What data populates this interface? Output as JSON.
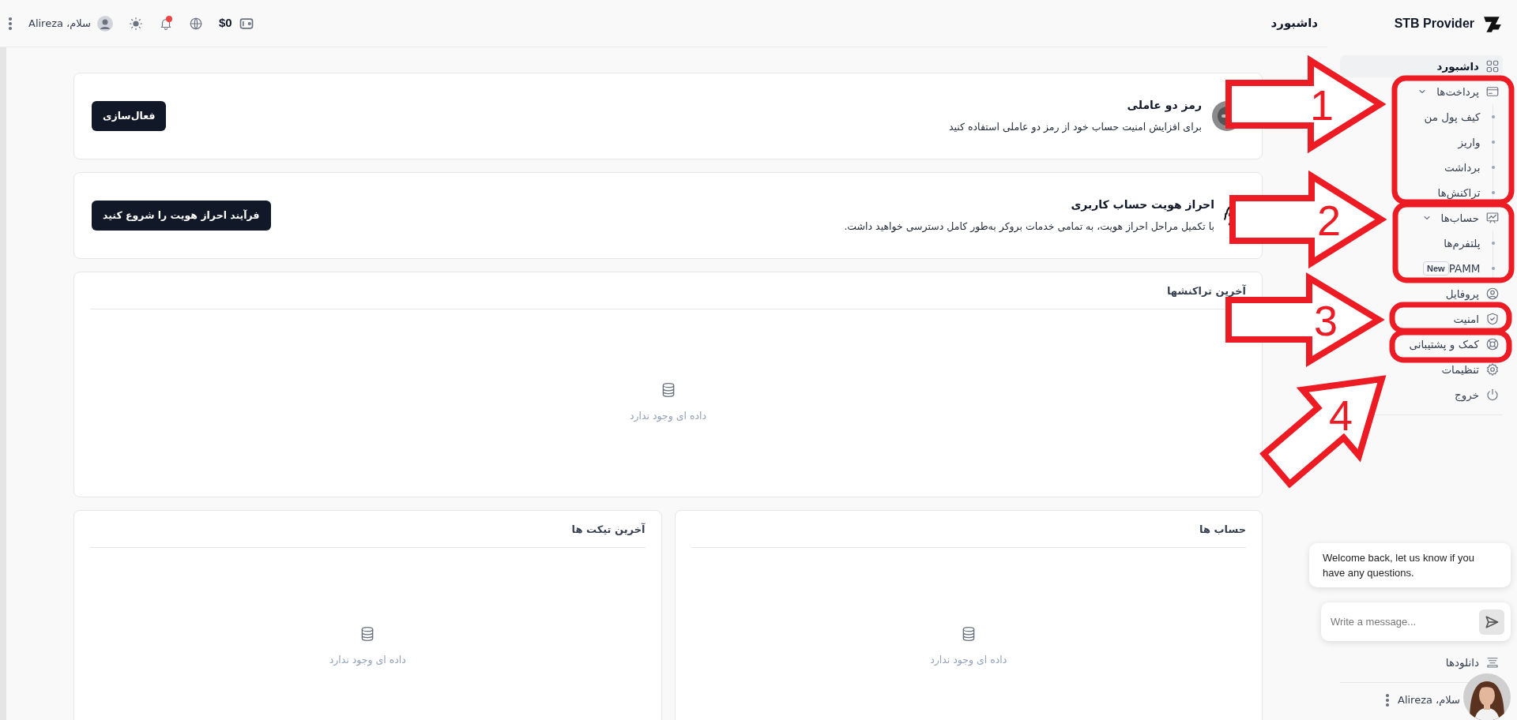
{
  "brand": {
    "name": "STB Provider"
  },
  "header": {
    "page_title": "داشبورد",
    "balance": "$0",
    "has_unread_notifications": true,
    "greeting": "سلام، Alireza"
  },
  "sidebar": {
    "items": [
      {
        "label": "داشبورد",
        "selected": true
      },
      {
        "label": "پرداخت‌ها",
        "selected": false,
        "expanded": true,
        "children": [
          {
            "label": "کیف پول من",
            "selected": false
          },
          {
            "label": "واریز",
            "selected": false
          },
          {
            "label": "برداشت",
            "selected": false
          },
          {
            "label": "تراکنش‌ها",
            "selected": false
          }
        ]
      },
      {
        "label": "حساب‌ها",
        "selected": false,
        "expanded": true,
        "children": [
          {
            "label": "پلتفرم‌ها",
            "selected": false
          },
          {
            "label": "PAMM",
            "selected": false,
            "badge": "New"
          }
        ]
      },
      {
        "label": "پروفایل",
        "selected": false
      },
      {
        "label": "امنیت",
        "selected": false
      },
      {
        "label": "کمک و پشتیبانی",
        "selected": false
      },
      {
        "label": "تنظیمات",
        "selected": false
      },
      {
        "label": "خروج",
        "selected": false
      }
    ],
    "footer_items": [
      {
        "label": "دانلودها",
        "selected": false
      }
    ],
    "user_greeting": "سلام، Alireza"
  },
  "prompts": [
    {
      "title": "رمز دو عاملی",
      "description": "برای افزایش امنیت حساب خود از رمز دو عاملی استفاده کنید",
      "button": "فعال‌سازی"
    },
    {
      "title": "احراز هویت حساب کاربری",
      "description": "با تکمیل مراحل احراز هویت، به تمامی خدمات بروکر به‌طور کامل دسترسی خواهید داشت.",
      "button": "فرآیند احراز هویت را شروع کنید"
    }
  ],
  "panels": [
    {
      "title": "آخرین تراکنشها",
      "empty_message": "داده ای وجود ندارد"
    }
  ],
  "bottom_panels": [
    {
      "title": "حساب ها",
      "empty_message": "داده ای وجود ندارد"
    },
    {
      "title": "آخرین تیکت ها",
      "empty_message": "داده ای وجود ندارد"
    }
  ],
  "chat": {
    "message": "Welcome back, let us know if you have any questions.",
    "input": {
      "placeholder": "Write a message..."
    }
  },
  "annotations": [
    {
      "label": "1"
    },
    {
      "label": "2"
    },
    {
      "label": "3"
    },
    {
      "label": "4"
    }
  ]
}
